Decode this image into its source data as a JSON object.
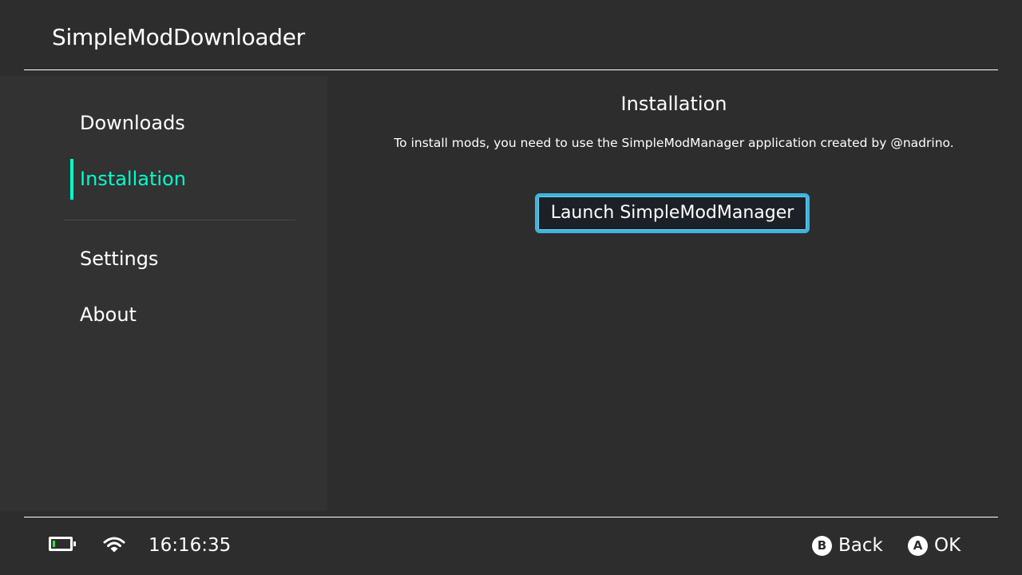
{
  "header": {
    "title": "SimpleModDownloader"
  },
  "sidebar": {
    "items": [
      {
        "label": "Downloads",
        "active": false
      },
      {
        "label": "Installation",
        "active": true
      },
      {
        "label": "Settings",
        "active": false
      },
      {
        "label": "About",
        "active": false
      }
    ]
  },
  "content": {
    "title": "Installation",
    "description": "To install mods, you need to use the SimpleModManager application created by @nadrino.",
    "launch_button_label": "Launch SimpleModManager"
  },
  "footer": {
    "battery_icon": "battery-icon",
    "wifi_icon": "wifi-icon",
    "time": "16:16:35",
    "hints": [
      {
        "button": "B",
        "label": "Back"
      },
      {
        "button": "A",
        "label": "OK"
      }
    ]
  },
  "colors": {
    "background": "#2d2d2d",
    "sidebar_background": "#323232",
    "accent": "#00ffcc",
    "button_border": "#3fb3de",
    "battery_level": "#3ce13c"
  }
}
